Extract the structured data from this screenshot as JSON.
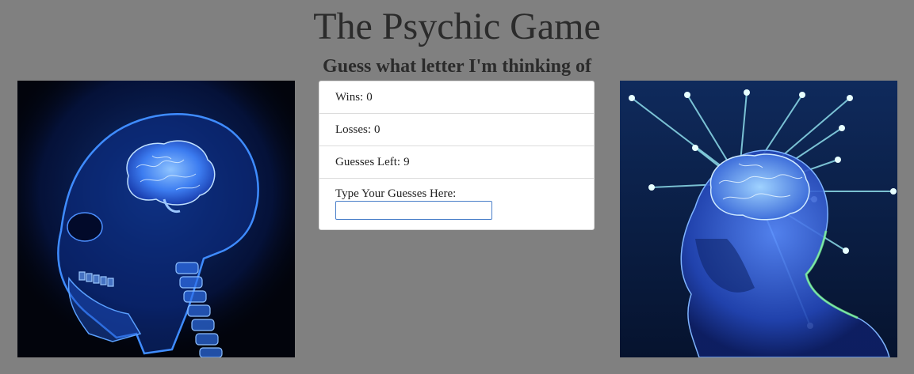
{
  "header": {
    "title": "The Psychic Game",
    "subtitle": "Guess what letter I'm thinking of"
  },
  "images": {
    "left": {
      "icon": "xray-skull-brain-image"
    },
    "right": {
      "icon": "glowing-brain-head-image"
    }
  },
  "scoreboard": {
    "wins_label": "Wins:",
    "wins_value": "0",
    "losses_label": "Losses:",
    "losses_value": "0",
    "guesses_left_label": "Guesses Left:",
    "guesses_left_value": "9",
    "guess_input_label": "Type Your Guesses Here:",
    "guess_input_value": ""
  },
  "colors": {
    "background": "#808080",
    "card": "#ffffff",
    "input_border": "#4a7fc9"
  }
}
